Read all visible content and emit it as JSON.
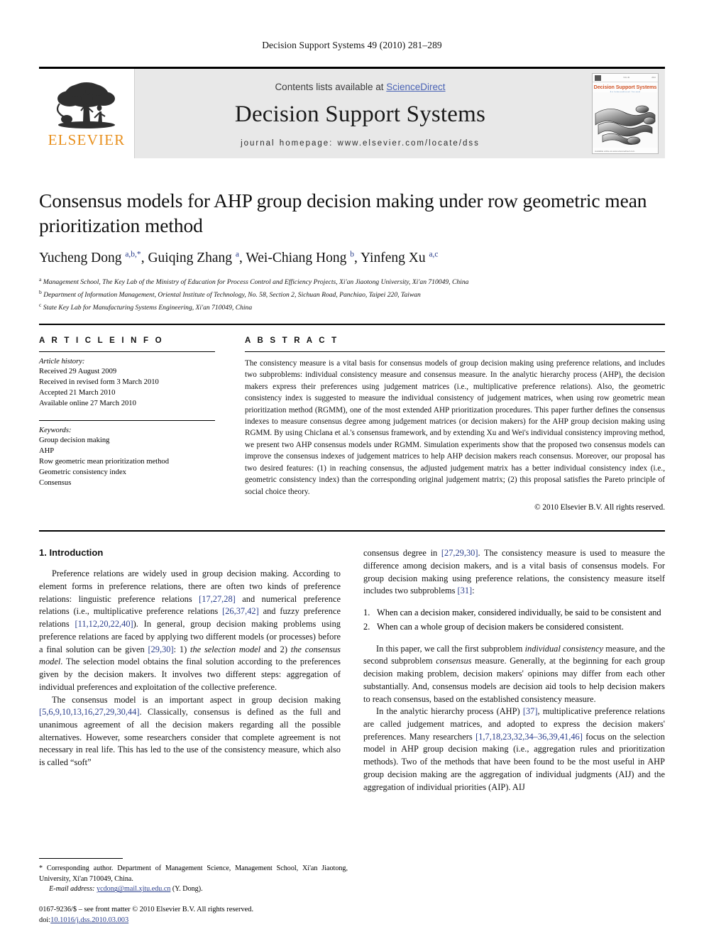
{
  "running_head": "Decision Support Systems 49 (2010) 281–289",
  "header": {
    "contents_prefix": "Contents lists available at ",
    "sciencedirect": "ScienceDirect",
    "journal_title": "Decision Support Systems",
    "homepage": "journal homepage: www.elsevier.com/locate/dss",
    "publisher_wordmark": "ELSEVIER",
    "cover": {
      "journal_name": "Decision Support Systems",
      "subtitle": "An International Journal"
    }
  },
  "article": {
    "title": "Consensus models for AHP group decision making under row geometric mean prioritization method",
    "authors_html": "Yucheng Dong <sup>a,b,*</sup>, Guiqing Zhang <sup>a</sup>, Wei-Chiang Hong <sup>b</sup>, Yinfeng Xu <sup>a,c</sup>",
    "affiliations": [
      {
        "marker": "a",
        "text": "Management School, The Key Lab of the Ministry of Education for Process Control and Efficiency Projects, Xi'an Jiaotong University, Xi'an 710049, China"
      },
      {
        "marker": "b",
        "text": "Department of Information Management, Oriental Institute of Technology, No. 58, Section 2, Sichuan Road, Panchiao, Taipei 220, Taiwan"
      },
      {
        "marker": "c",
        "text": "State Key Lab for Manufacturing Systems Engineering, Xi'an 710049, China"
      }
    ]
  },
  "article_info": {
    "heading": "A R T I C L E    I N F O",
    "history_label": "Article history:",
    "history": [
      "Received 29 August 2009",
      "Received in revised form 3 March 2010",
      "Accepted 21 March 2010",
      "Available online 27 March 2010"
    ],
    "keywords_label": "Keywords:",
    "keywords": [
      "Group decision making",
      "AHP",
      "Row geometric mean prioritization method",
      "Geometric consistency index",
      "Consensus"
    ]
  },
  "abstract": {
    "heading": "A B S T R A C T",
    "text": "The consistency measure is a vital basis for consensus models of group decision making using preference relations, and includes two subproblems: individual consistency measure and consensus measure. In the analytic hierarchy process (AHP), the decision makers express their preferences using judgement matrices (i.e., multiplicative preference relations). Also, the geometric consistency index is suggested to measure the individual consistency of judgement matrices, when using row geometric mean prioritization method (RGMM), one of the most extended AHP prioritization procedures. This paper further defines the consensus indexes to measure consensus degree among judgement matrices (or decision makers) for the AHP group decision making using RGMM. By using Chiclana et al.'s consensus framework, and by extending Xu and Wei's individual consistency improving method, we present two AHP consensus models under RGMM. Simulation experiments show that the proposed two consensus models can improve the consensus indexes of judgement matrices to help AHP decision makers reach consensus. Moreover, our proposal has two desired features: (1) in reaching consensus, the adjusted judgement matrix has a better individual consistency index (i.e., geometric consistency index) than the corresponding original judgement matrix; (2) this proposal satisfies the Pareto principle of social choice theory.",
    "copyright": "© 2010 Elsevier B.V. All rights reserved."
  },
  "body": {
    "section_title": "1. Introduction",
    "left_paragraphs": [
      "Preference relations are widely used in group decision making. According to element forms in preference relations, there are often two kinds of preference relations: linguistic preference relations <span class=\"ref\">[17,27,28]</span> and numerical preference relations (i.e., multiplicative preference relations <span class=\"ref\">[26,37,42]</span> and fuzzy preference relations <span class=\"ref\">[11,12,20,22,40]</span>). In general, group decision making problems using preference relations are faced by applying two different models (or processes) before a final solution can be given <span class=\"ref\">[29,30]</span>: 1) <i>the selection model</i> and 2) <i>the consensus model</i>. The selection model obtains the final solution according to the preferences given by the decision makers. It involves two different steps: aggregation of individual preferences and exploitation of the collective preference.",
      "The consensus model is an important aspect in group decision making <span class=\"ref\">[5,6,9,10,13,16,27,29,30,44]</span>. Classically, consensus is defined as the full and unanimous agreement of all the decision makers regarding all the possible alternatives. However, some researchers consider that complete agreement is not necessary in real life. This has led to the use of the consistency measure, which also is called “soft”"
    ],
    "right_intro": "consensus degree in <span class=\"ref\">[27,29,30]</span>. The consistency measure is used to measure the difference among decision makers, and is a vital basis of consensus models. For group decision making using preference relations, the consistency measure itself includes two subproblems <span class=\"ref\">[31]</span>:",
    "numbered_items": [
      {
        "num": "1.",
        "text": "When can a decision maker, considered individually, be said to be consistent and"
      },
      {
        "num": "2.",
        "text": "When can a whole group of decision makers be considered consistent."
      }
    ],
    "right_paragraphs": [
      "In this paper, we call the first subproblem <i>individual consistency</i> measure, and the second subproblem <i>consensus</i> measure. Generally, at the beginning for each group decision making problem, decision makers' opinions may differ from each other substantially. And, consensus models are decision aid tools to help decision makers to reach consensus, based on the established consistency measure.",
      "In the analytic hierarchy process (AHP) <span class=\"ref\">[37]</span>, multiplicative preference relations are called judgement matrices, and adopted to express the decision makers' preferences. Many researchers <span class=\"ref\">[1,7,18,23,32,34–36,39,41,46]</span> focus on the selection model in AHP group decision making (i.e., aggregation rules and prioritization methods). Two of the methods that have been found to be the most useful in AHP group decision making are the aggregation of individual judgments (AIJ) and the aggregation of individual priorities (AIP). AIJ"
    ]
  },
  "footnote": {
    "corresponding_html": "* Corresponding author. Department of Management Science, Management School, Xi'an Jiaotong, University, Xi'an 710049, China.",
    "email_label": "E-mail address:",
    "email": "ycdong@mail.xjtu.edu.cn",
    "email_suffix": "(Y. Dong)."
  },
  "issn": {
    "line1": "0167-9236/$ – see front matter © 2010 Elsevier B.V. All rights reserved.",
    "doi_label": "doi:",
    "doi": "10.1016/j.dss.2010.03.003"
  },
  "colors": {
    "link_blue": "#2b3f8c",
    "sciencedirect_blue": "#4a63b5",
    "elsevier_orange": "#E8901E",
    "cover_title_red": "#D1562A"
  }
}
